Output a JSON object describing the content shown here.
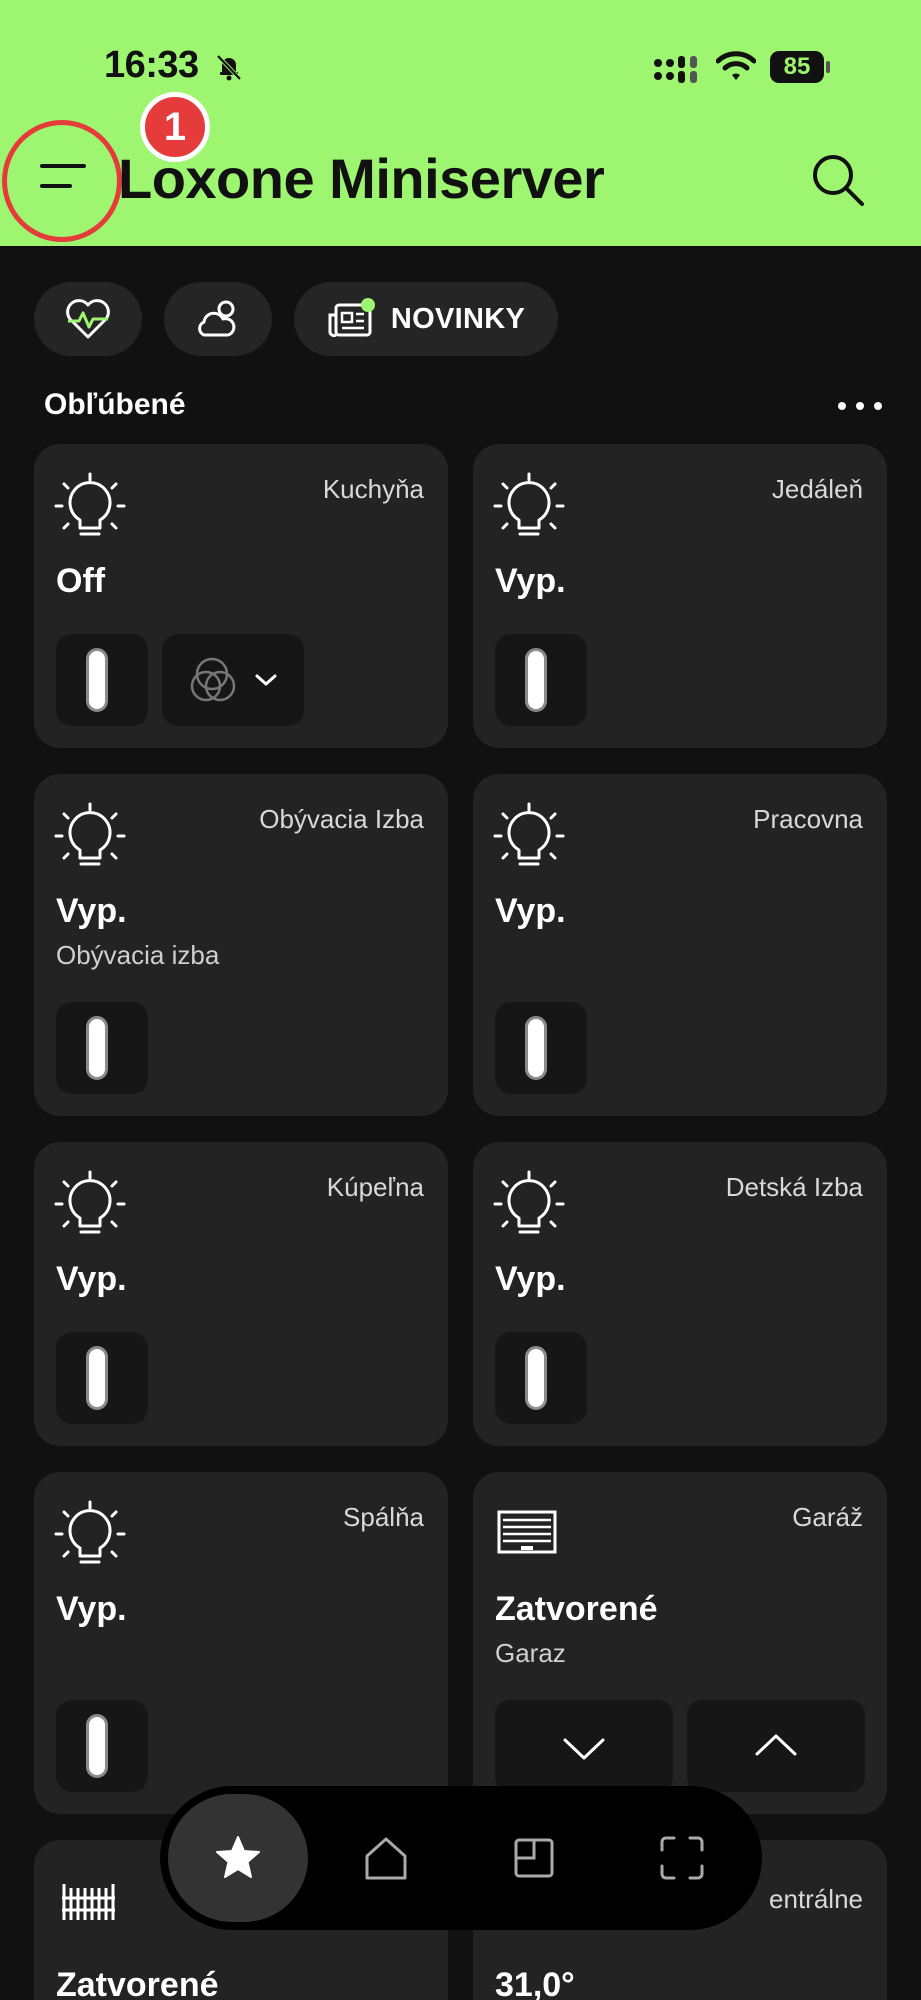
{
  "status_bar": {
    "time": "16:33",
    "battery": "85"
  },
  "header": {
    "title": "Loxone Miniserver",
    "annotation_number": "1"
  },
  "chips": {
    "news_label": "NOVINKY"
  },
  "favorites": {
    "title": "Obľúbené"
  },
  "cards": [
    {
      "room": "Kuchyňa",
      "state": "Off",
      "sub": ""
    },
    {
      "room": "Jedáleň",
      "state": "Vyp.",
      "sub": ""
    },
    {
      "room": "Obývacia Izba",
      "state": "Vyp.",
      "sub": "Obývacia izba"
    },
    {
      "room": "Pracovna",
      "state": "Vyp.",
      "sub": ""
    },
    {
      "room": "Kúpeľna",
      "state": "Vyp.",
      "sub": ""
    },
    {
      "room": "Detská Izba",
      "state": "Vyp.",
      "sub": ""
    },
    {
      "room": "Spálňa",
      "state": "Vyp.",
      "sub": ""
    },
    {
      "room": "Garáž",
      "state": "Zatvorené",
      "sub": "Garaz"
    },
    {
      "room": "",
      "state": "Zatvorené",
      "sub": ""
    },
    {
      "room": "entrálne",
      "state": "31,0°",
      "sub": ""
    }
  ],
  "colors": {
    "header_bg": "#9ef56f",
    "accent": "#9ef56f",
    "annotation": "#e63b3b"
  },
  "icons": {
    "header": [
      "menu-icon",
      "search-icon"
    ],
    "chips": [
      "health-icon",
      "weather-icon",
      "news-icon"
    ],
    "cards": [
      "lightbulb-icon",
      "garage-door-icon",
      "gate-icon",
      "thermostat-icon"
    ],
    "nav": [
      "star-icon",
      "home-icon",
      "room-icon",
      "scan-icon"
    ]
  }
}
